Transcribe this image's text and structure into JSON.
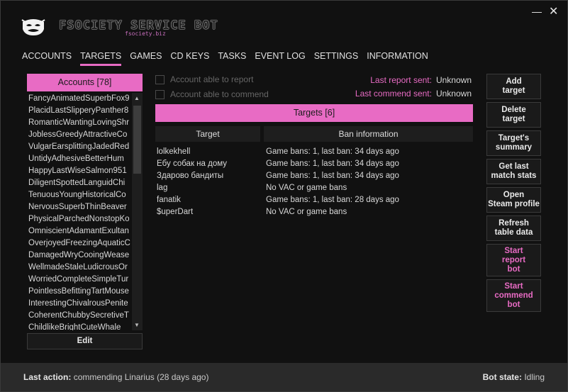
{
  "window": {
    "minimize": "—",
    "close": "✕"
  },
  "header": {
    "title": "FSOCIETY SERVICE BOT",
    "subtitle": "fsociety.biz"
  },
  "tabs": [
    "ACCOUNTS",
    "TARGETS",
    "GAMES",
    "CD KEYS",
    "TASKS",
    "EVENT LOG",
    "SETTINGS",
    "INFORMATION"
  ],
  "active_tab": "TARGETS",
  "accounts": {
    "header": "Accounts [78]",
    "items": [
      "FancyAnimatedSuperbFox9",
      "PlacidLastSlipperyPanther8",
      "RomanticWantingLovingShr",
      "JoblessGreedyAttractiveCo",
      "VulgarEarsplittingJadedRed",
      "UntidyAdhesiveBetterHum",
      "HappyLastWiseSalmon951",
      "DiligentSpottedLanguidChi",
      "TenuousYoungHistoricalCo",
      "NervousSuperbThinBeaver",
      "PhysicalParchedNonstopKo",
      "OmniscientAdamantExultan",
      "OverjoyedFreezingAquaticC",
      "DamagedWryCooingWease",
      "WellmadeStaleLudicrousOr",
      "WorriedCompleteSimpleTur",
      "PointlessBefittingTartMouse",
      "InterestingChivalrousPenite",
      "CoherentChubbySecretiveT",
      "ChildlikeBrightCuteWhale"
    ],
    "edit_label": "Edit"
  },
  "options": {
    "report_label": "Account able to report",
    "commend_label": "Account able to commend"
  },
  "status": {
    "last_report_label": "Last report sent:",
    "last_report_value": "Unknown",
    "last_commend_label": "Last commend sent:",
    "last_commend_value": "Unknown"
  },
  "targets": {
    "header": "Targets [6]",
    "col_target": "Target",
    "col_ban": "Ban information",
    "rows": [
      {
        "target": "lolkekhell",
        "ban": "Game bans: 1, last ban: 34 days ago"
      },
      {
        "target": "Ебу собак на дому",
        "ban": "Game bans: 1, last ban: 34 days ago"
      },
      {
        "target": "Здарово бандиты",
        "ban": "Game bans: 1, last ban: 34 days ago"
      },
      {
        "target": "lag",
        "ban": "No VAC or game bans"
      },
      {
        "target": "fanatik",
        "ban": "Game bans: 1, last ban: 28 days ago"
      },
      {
        "target": "$uperDart",
        "ban": "No VAC or game bans"
      }
    ]
  },
  "side_buttons": [
    {
      "label": "Add\ntarget",
      "name": "add-target-button",
      "pink": false
    },
    {
      "label": "Delete\ntarget",
      "name": "delete-target-button",
      "pink": false
    },
    {
      "label": "Target's\nsummary",
      "name": "target-summary-button",
      "pink": false
    },
    {
      "label": "Get last\nmatch stats",
      "name": "get-last-match-stats-button",
      "pink": false
    },
    {
      "label": "Open\nSteam profile",
      "name": "open-steam-profile-button",
      "pink": false
    },
    {
      "label": "Refresh\ntable data",
      "name": "refresh-table-data-button",
      "pink": false
    },
    {
      "label": "Start\nreport\nbot",
      "name": "start-report-bot-button",
      "pink": true
    },
    {
      "label": "Start\ncommend\nbot",
      "name": "start-commend-bot-button",
      "pink": true
    }
  ],
  "footer": {
    "last_action_label": "Last action:",
    "last_action_value": "commending Linarius (28 days ago)",
    "bot_state_label": "Bot state:",
    "bot_state_value": "Idling"
  },
  "colors": {
    "accent": "#e86bc4",
    "bg": "#111111"
  }
}
